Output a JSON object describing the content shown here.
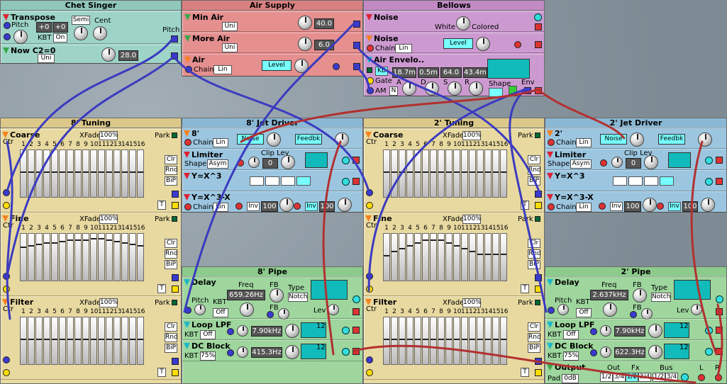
{
  "panels": {
    "chet": {
      "title": "Chet Singer"
    },
    "air": {
      "title": "Air Supply"
    },
    "bellows": {
      "title": "Bellows"
    },
    "tun8": {
      "title": "8' Tuning"
    },
    "jet8": {
      "title": "8' Jet Driver"
    },
    "tun2": {
      "title": "2' Tuning"
    },
    "jet2": {
      "title": "2' Jet Driver"
    },
    "pipe8": {
      "title": "8' Pipe"
    },
    "pipe2": {
      "title": "2' Pipe"
    }
  },
  "chet": {
    "transpose": "Transpose",
    "pitch": "Pitch",
    "semi": "Semi",
    "cent": "Cent",
    "val1": "+0",
    "val2": "+0",
    "kbt": "KBT",
    "on": "On",
    "pitch_out": "Pitch",
    "now": "Now C2=0",
    "uni": "Uni",
    "nowval": "28.0"
  },
  "air": {
    "minair": "Min Air",
    "minuni": "Uni",
    "minval": "40.0",
    "moreair": "More Air",
    "moreuni": "Uni",
    "moreval": "6.0",
    "air": "Air",
    "chain": "Chain",
    "lin": "Lin",
    "level": "Level"
  },
  "bellows": {
    "noise": "Noise",
    "white": "White",
    "colored": "Colored",
    "noise2": "Noise",
    "chain": "Chain",
    "lin": "Lin",
    "level": "Level",
    "env": "Air Envelo..",
    "kb": "KB",
    "gate": "Gate",
    "am": "AM",
    "n": "N",
    "a": "A",
    "d": "D",
    "s": "S",
    "r": "R",
    "av": "18.7m",
    "dv": "0.5m",
    "sv": "64.0",
    "rv": "43.4m",
    "shape": "Shape",
    "envout": "Env"
  },
  "tuning": {
    "coarse": "Coarse",
    "fine": "Fine",
    "filter": "Filter",
    "xfade": "XFade",
    "xfval": "100%",
    "park": "Park",
    "ctr": "Ctr",
    "clr": "Clr",
    "rnd": "Rnd",
    "bip": "BiP",
    "t": "T",
    "nums": [
      "1",
      "2",
      "3",
      "4",
      "5",
      "6",
      "7",
      "8",
      "9",
      "10",
      "11",
      "12",
      "13",
      "14",
      "15",
      "16"
    ]
  },
  "jet": {
    "n8": "8'",
    "n2": "2'",
    "chain": "Chain",
    "lin": "Lin",
    "noise": "Noise",
    "feedbk8": "Feedbk",
    "feedbk2": "Feedbk",
    "limiter": "Limiter",
    "cliplev": "Clip Lev",
    "shape": "Shape",
    "asym": "Asym",
    "clipval": "0",
    "yx3": "Y=X^3",
    "yx3x": "Y=X^3-X",
    "inv": "Inv",
    "v100": "100"
  },
  "pipe": {
    "delay": "Delay",
    "freq": "Freq",
    "fb": "FB",
    "type": "Type",
    "notch": "Notch",
    "pitch": "Pitch",
    "kbt": "KBT",
    "off": "Off",
    "lev": "Lev",
    "freq8": "659.26Hz",
    "freq2": "2.637kHz",
    "looplpf": "Loop LPF",
    "lpfval": "7.90kHz",
    "v12": "12",
    "dcblock": "DC Block",
    "kbt75": "75%",
    "dc8": "415.3Hz",
    "dc2": "622.3Hz",
    "output": "Output",
    "pad": "Pad",
    "padval": "0dB",
    "out": "Out",
    "fx": "Fx",
    "bus": "Bus",
    "o1": "1/2",
    "o2": "3/4",
    "l": "L",
    "r": "R"
  },
  "colors": {
    "teal": "#9ed4c8",
    "salmon": "#e58f8f",
    "violet": "#cc9ad0",
    "tan": "#e8d9a0",
    "blue": "#9cc6e0",
    "green": "#9ed69e"
  }
}
